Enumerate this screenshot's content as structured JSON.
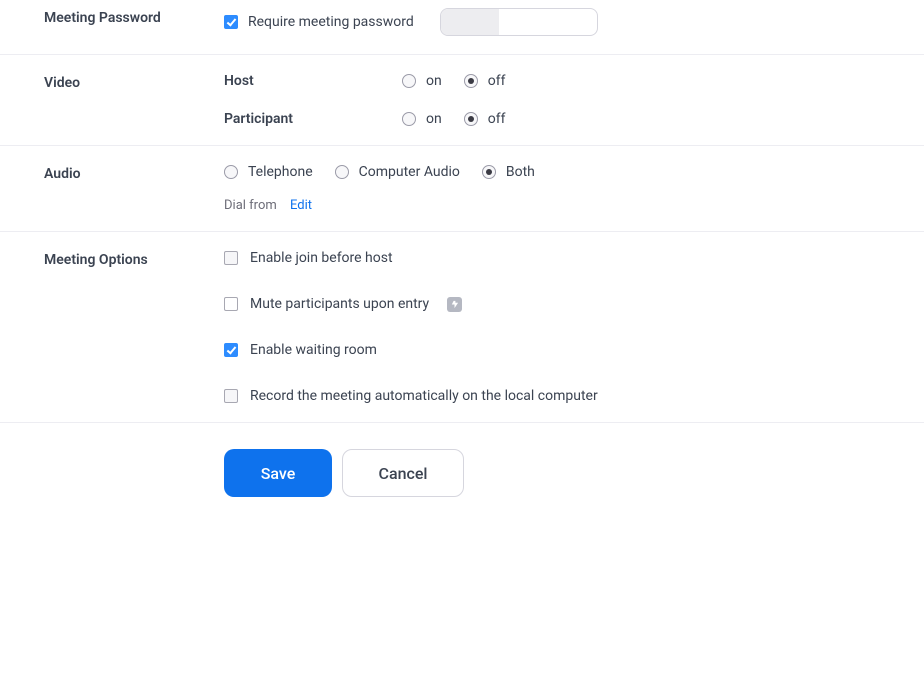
{
  "meetingPassword": {
    "label": "Meeting Password",
    "requireLabel": "Require meeting password",
    "checked": true
  },
  "video": {
    "label": "Video",
    "host": {
      "label": "Host",
      "on": "on",
      "off": "off",
      "value": "off"
    },
    "participant": {
      "label": "Participant",
      "on": "on",
      "off": "off",
      "value": "off"
    }
  },
  "audio": {
    "label": "Audio",
    "telephone": "Telephone",
    "computer": "Computer Audio",
    "both": "Both",
    "value": "both",
    "dialFrom": "Dial from",
    "editLink": "Edit"
  },
  "meetingOptions": {
    "label": "Meeting Options",
    "joinBeforeHost": {
      "label": "Enable join before host",
      "checked": false
    },
    "muteOnEntry": {
      "label": "Mute participants upon entry",
      "checked": false
    },
    "waitingRoom": {
      "label": "Enable waiting room",
      "checked": true
    },
    "recordAuto": {
      "label": "Record the meeting automatically on the local computer",
      "checked": false
    }
  },
  "buttons": {
    "save": "Save",
    "cancel": "Cancel"
  }
}
